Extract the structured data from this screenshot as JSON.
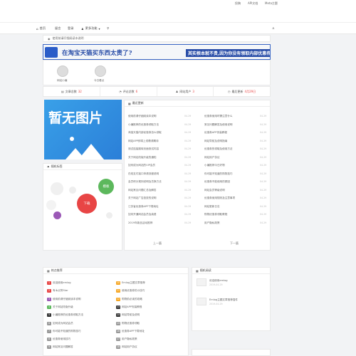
{
  "topbar": {
    "links": [
      "投稿",
      "API文档",
      "Meta主题"
    ]
  },
  "nav": {
    "items": [
      "首页",
      "留言",
      "登录",
      "更多功能"
    ]
  },
  "notice": {
    "text": "使用前请仔细阅读本说明"
  },
  "banner": {
    "main": "在淘宝天猫买东西太贵了?",
    "sub": "其实根本就不贵,因为你没有领取内部优惠券"
  },
  "avatars": [
    {
      "name": "网站小编"
    },
    {
      "name": "今日看点"
    }
  ],
  "stats": [
    {
      "label": "文章总数",
      "value": "32"
    },
    {
      "label": "评论总数",
      "value": "6"
    },
    {
      "label": "网站用户",
      "value": "3"
    },
    {
      "label": "最后更新",
      "value": "4月29日"
    }
  ],
  "noimage": {
    "text": "暂无图片"
  },
  "recent": {
    "title": "最近更新",
    "left": [
      "使用前请仔细阅读本说明",
      "小编推荐的优惠券领取方法",
      "淘宝天猫内部优惠券怎么领取",
      "网站APP即将上线敬请期待",
      "测试连接跳转页面测试内容",
      "关于网站改版升级的通知",
      "如何成为网站的VIP会员",
      "在线支付接口申请流程说明",
      "会员积分规则说明及兑换方法",
      "网站常见问题汇总及解答",
      "关于网站广告投放的说明",
      "江苏省优惠券APP下载地址",
      "如何开通网站会员及续费",
      "2019年新品活动推荐"
    ],
    "right": [
      "优惠券使用时需注意什么",
      "常见问题解答及使用说明",
      "优惠券APP安装教程",
      "网站导航及说明指南",
      "优惠券的领取及使用方法",
      "网站用户协议",
      "小编推荐今日好物",
      "你可能不知道的购物技巧",
      "优惠券不能使用的原因",
      "网站会员等级说明",
      "优惠券使用规则及注意事项",
      "网站更新日志",
      "购物优惠券领取教程",
      "用户隐私政策"
    ],
    "date": "04-29",
    "prev": "上一篇",
    "next": "下一篇"
  },
  "cloud": {
    "title": "随机标签",
    "tags": [
      "下载",
      "模板",
      "教程",
      "插件"
    ]
  },
  "hot": {
    "title": "热点推荐",
    "items": [
      "欢迎使用emlog",
      "有木点赞Star",
      "使用前请仔细阅读本说明",
      "关于网站改版升级",
      "小编推荐的优惠券领取方法",
      "如何成为网站会员",
      "你可能不知道的购物技巧",
      "优惠券使用技巧",
      "网站常见问题解答",
      "Emlog主题文章推荐",
      "使用优惠券的小技巧",
      "购物前必读的攻略",
      "网站APP安装教程",
      "网站导航及说明",
      "购物优惠券领取",
      "优惠券APP下载地址",
      "用户隐私政策",
      "网站用户协议"
    ]
  },
  "random": {
    "title": "随机阅读",
    "items": [
      {
        "t": "欢迎使用emlog",
        "d": "2019-04-29"
      },
      {
        "t": "Emlog主题文章推荐插件",
        "d": "2019-04-29"
      }
    ]
  },
  "colors": {
    "accent": "#2a5cc8",
    "red": "#e84545",
    "orange": "#f5a623",
    "green": "#5cb85c"
  }
}
